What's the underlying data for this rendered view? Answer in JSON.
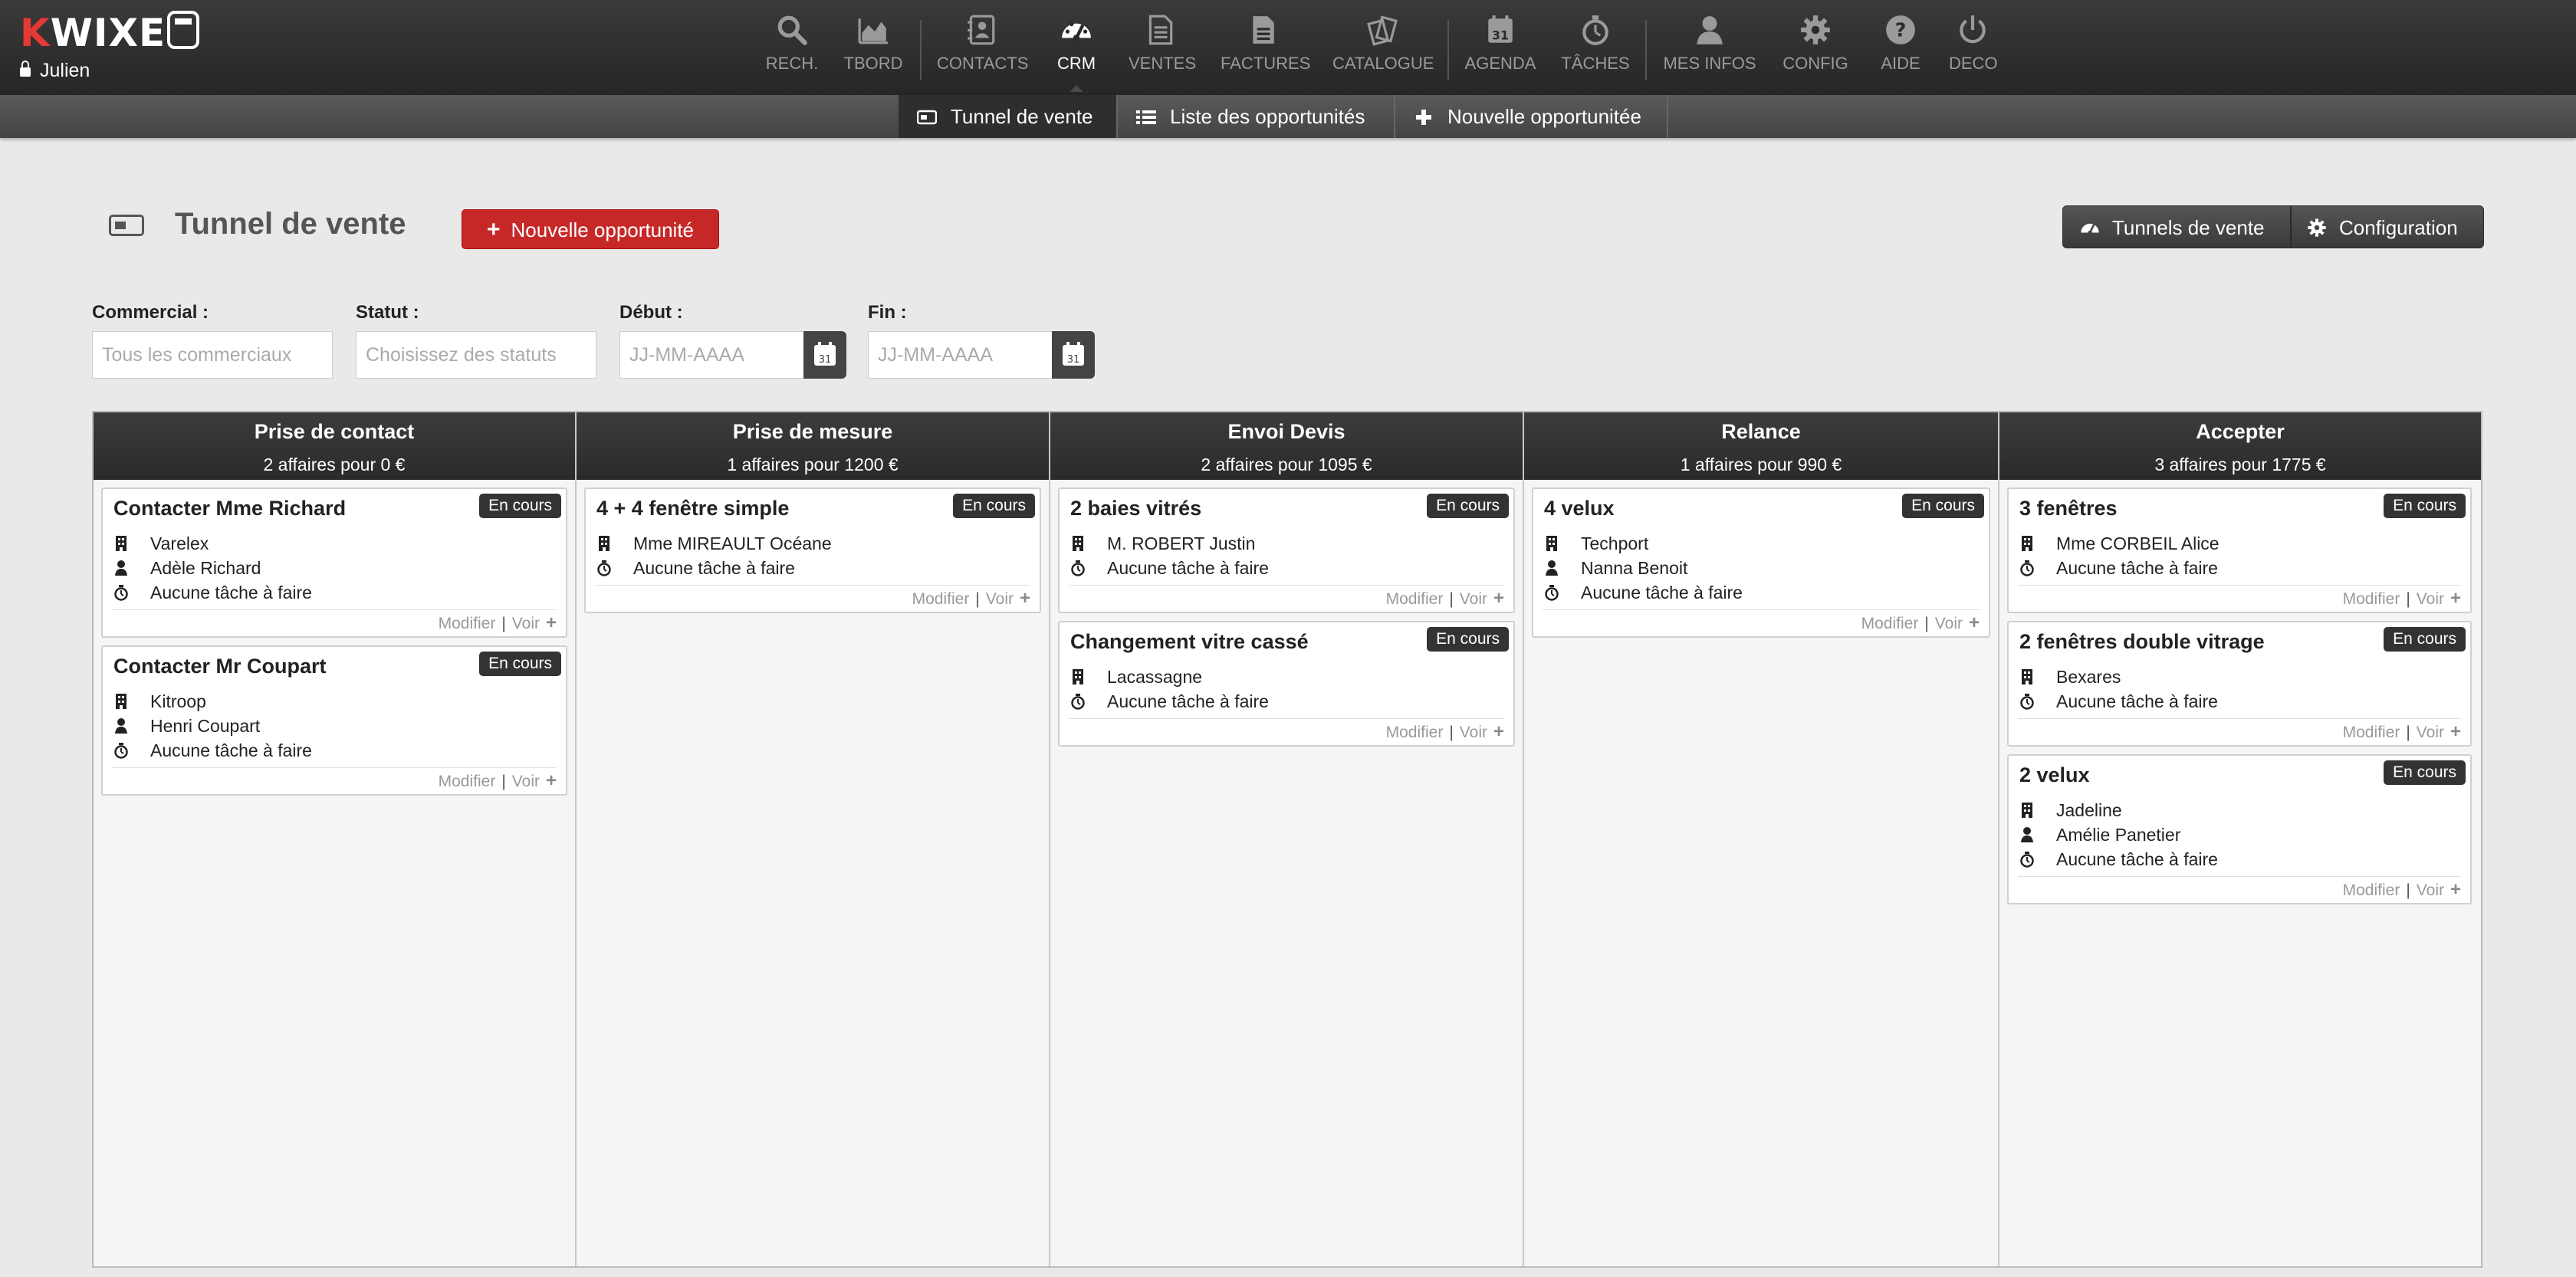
{
  "app": {
    "logo_k": "K",
    "logo_rest": "WIXE",
    "user": "Julien"
  },
  "nav": [
    {
      "label": "RECH.",
      "icon": "search-icon"
    },
    {
      "label": "TBORD",
      "icon": "area-chart-icon"
    },
    {
      "label": "CONTACTS",
      "icon": "address-book-icon"
    },
    {
      "label": "CRM",
      "icon": "dashboard-icon"
    },
    {
      "label": "VENTES",
      "icon": "document-icon"
    },
    {
      "label": "FACTURES",
      "icon": "invoice-icon"
    },
    {
      "label": "CATALOGUE",
      "icon": "catalogue-icon"
    },
    {
      "label": "AGENDA",
      "icon": "calendar-icon"
    },
    {
      "label": "TÂCHES",
      "icon": "stopwatch-icon"
    },
    {
      "label": "MES INFOS",
      "icon": "user-icon"
    },
    {
      "label": "CONFIG",
      "icon": "gear-icon"
    },
    {
      "label": "AIDE",
      "icon": "help-icon"
    },
    {
      "label": "DECO",
      "icon": "power-icon"
    }
  ],
  "subnav": [
    {
      "label": "Tunnel de vente",
      "icon": "funnel-card-icon"
    },
    {
      "label": "Liste des opportunités",
      "icon": "list-icon"
    },
    {
      "label": "Nouvelle opportunitée",
      "icon": "plus-icon"
    }
  ],
  "header": {
    "title": "Tunnel de vente",
    "new_button": "Nouvelle opportunité",
    "tunnels_button": "Tunnels de vente",
    "config_button": "Configuration"
  },
  "filters": {
    "commercial": {
      "label": "Commercial :",
      "placeholder": "Tous les commerciaux"
    },
    "statut": {
      "label": "Statut :",
      "placeholder": "Choisissez des statuts"
    },
    "debut": {
      "label": "Début :",
      "placeholder": "JJ-MM-AAAA"
    },
    "fin": {
      "label": "Fin :",
      "placeholder": "JJ-MM-AAAA"
    },
    "calendar_day": "31"
  },
  "columns": [
    {
      "title": "Prise de contact",
      "summary": "2 affaires pour 0 €",
      "cards": [
        {
          "title": "Contacter Mme Richard",
          "status": "En cours",
          "company": "Varelex",
          "contact": "Adèle Richard",
          "tasks": "Aucune tâche à faire"
        },
        {
          "title": "Contacter Mr Coupart",
          "status": "En cours",
          "company": "Kitroop",
          "contact": "Henri Coupart",
          "tasks": "Aucune tâche à faire"
        }
      ]
    },
    {
      "title": "Prise de mesure",
      "summary": "1 affaires pour 1200 €",
      "cards": [
        {
          "title": "4 + 4 fenêtre simple",
          "status": "En cours",
          "company": "Mme MIREAULT Océane",
          "tasks": "Aucune tâche à faire"
        }
      ]
    },
    {
      "title": "Envoi Devis",
      "summary": "2 affaires pour 1095 €",
      "cards": [
        {
          "title": "2 baies vitrés",
          "status": "En cours",
          "company": "M. ROBERT Justin",
          "tasks": "Aucune tâche à faire"
        },
        {
          "title": "Changement vitre cassé",
          "status": "En cours",
          "company": "Lacassagne",
          "tasks": "Aucune tâche à faire"
        }
      ]
    },
    {
      "title": "Relance",
      "summary": "1 affaires pour 990 €",
      "cards": [
        {
          "title": "4 velux",
          "status": "En cours",
          "company": "Techport",
          "contact": "Nanna Benoit",
          "tasks": "Aucune tâche à faire"
        }
      ]
    },
    {
      "title": "Accepter",
      "summary": "3 affaires pour 1775 €",
      "cards": [
        {
          "title": "3 fenêtres",
          "status": "En cours",
          "company": "Mme CORBEIL Alice",
          "tasks": "Aucune tâche à faire"
        },
        {
          "title": "2 fenêtres double vitrage",
          "status": "En cours",
          "company": "Bexares",
          "tasks": "Aucune tâche à faire"
        },
        {
          "title": "2 velux",
          "status": "En cours",
          "company": "Jadeline",
          "contact": "Amélie Panetier",
          "tasks": "Aucune tâche à faire"
        }
      ]
    }
  ],
  "card_actions": {
    "edit": "Modifier",
    "separator": "|",
    "view": "Voir",
    "add": "+"
  },
  "colors": {
    "accent_red": "#c62828",
    "topbar": "#2e2e2e",
    "badge": "#333333"
  }
}
